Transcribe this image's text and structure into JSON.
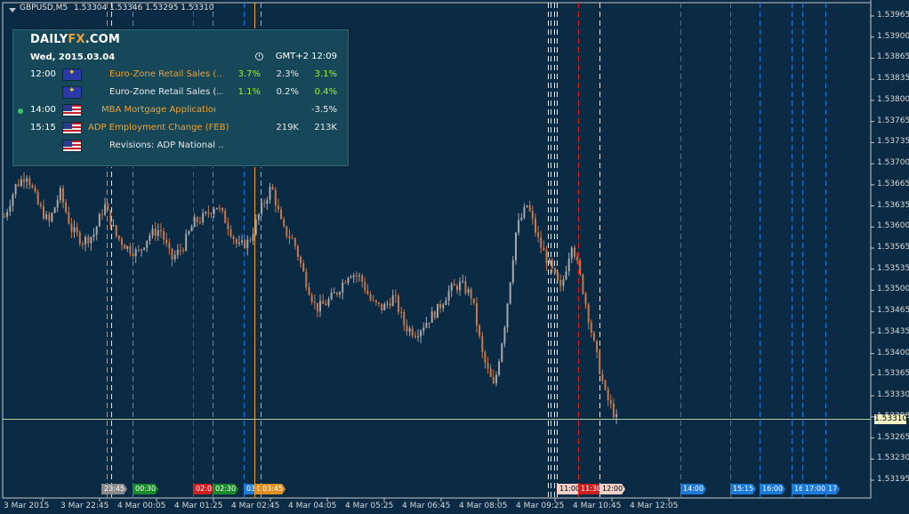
{
  "symbol": {
    "icon": "dropdown-triangle-icon",
    "title": "GBPUSD,M5",
    "ohlc": "1.53304 1.53346 1.53295 1.53310"
  },
  "panel": {
    "logo_prefix": "DAILY",
    "logo_fx": "FX",
    "logo_suffix": ".COM",
    "date": "Wed, 2015.03.04",
    "clock_icon": "clock-icon",
    "timezone": "GMT+2 12:09",
    "rows": [
      {
        "time": "12:00",
        "flag": "eu-flag",
        "name": "Euro-Zone Retail Sales (...",
        "name_color": "orange",
        "actual": "3.7%",
        "actual_color": "green",
        "forecast": "2.3%",
        "previous": "3.1%",
        "previous_color": "green",
        "dot": false
      },
      {
        "time": "",
        "flag": "eu-flag",
        "name": "Euro-Zone Retail Sales (...",
        "name_color": "white",
        "actual": "1.1%",
        "actual_color": "green",
        "forecast": "0.2%",
        "previous": "0.4%",
        "previous_color": "green",
        "dot": false
      },
      {
        "time": "14:00",
        "flag": "us-flag",
        "name": "MBA Mortgage Application...",
        "name_color": "orange",
        "actual": "",
        "actual_color": "white",
        "forecast": "",
        "previous": "-3.5%",
        "previous_color": "white",
        "dot": true
      },
      {
        "time": "15:15",
        "flag": "us-flag",
        "name": "ADP Employment Change (FEB)",
        "name_color": "orange",
        "actual": "",
        "actual_color": "white",
        "forecast": "219K",
        "previous": "213K",
        "previous_color": "white",
        "dot": false
      },
      {
        "time": "",
        "flag": "us-flag",
        "name": "Revisions: ADP National ...",
        "name_color": "white",
        "actual": "",
        "actual_color": "white",
        "forecast": "",
        "previous": "",
        "previous_color": "white",
        "dot": false
      }
    ]
  },
  "chart_data": {
    "type": "candlestick",
    "price_axis_labels": [
      "1.53965",
      "1.53900",
      "1.53865",
      "1.53835",
      "1.53800",
      "1.53765",
      "1.53735",
      "1.53700",
      "1.53665",
      "1.53635",
      "1.53600",
      "1.53565",
      "1.53535",
      "1.53500",
      "1.53465",
      "1.53435",
      "1.53400",
      "1.53365",
      "1.53330",
      "1.53298",
      "1.53265",
      "1.53230",
      "1.53195"
    ],
    "time_axis_labels": [
      "3 Mar 2015",
      "3 Mar 22:45",
      "4 Mar 00:05",
      "4 Mar 01:25",
      "4 Mar 02:45",
      "4 Mar 04:05",
      "4 Mar 05:25",
      "4 Mar 06:45",
      "4 Mar 08:05",
      "4 Mar 09:25",
      "4 Mar 10:45",
      "4 Mar 12:05"
    ],
    "current_price": "1.53310",
    "y_range": [
      1.531806,
      1.539896
    ],
    "closes": [
      1.5364,
      1.5369,
      1.5371,
      1.5366,
      1.5363,
      1.5368,
      1.5362,
      1.536,
      1.5361,
      1.5366,
      1.5361,
      1.5359,
      1.5358,
      1.5361,
      1.5362,
      1.5357,
      1.5359,
      1.5363,
      1.5364,
      1.5366,
      1.5363,
      1.5359,
      1.536,
      1.5365,
      1.5369,
      1.5362,
      1.536,
      1.5354,
      1.5349,
      1.535,
      1.5352,
      1.5355,
      1.5354,
      1.535,
      1.5349,
      1.5351,
      1.5346,
      1.5345,
      1.5347,
      1.5349,
      1.5352,
      1.5353,
      1.5351,
      1.5341,
      1.5336,
      1.5347,
      1.5362,
      1.5366,
      1.536,
      1.5356,
      1.5352,
      1.536,
      1.5352,
      1.5343,
      1.5335,
      1.5331
    ],
    "vlines": [
      {
        "pos": 0.1202,
        "color": "#9a9a9a",
        "style": "dash"
      },
      {
        "pos": 0.1254,
        "color": "#e8e8e8",
        "style": "dash"
      },
      {
        "pos": 0.1491,
        "color": "#30c030",
        "style": "dash"
      },
      {
        "pos": 0.2193,
        "color": "#e02020",
        "style": "dash"
      },
      {
        "pos": 0.2421,
        "color": "#30c030",
        "style": "dash"
      },
      {
        "pos": 0.2772,
        "color": "#1e7ad8",
        "style": "dash"
      },
      {
        "pos": 0.2895,
        "color": "#f0a030",
        "style": "solid"
      },
      {
        "pos": 0.2974,
        "color": "#f0a030",
        "style": "dash"
      },
      {
        "pos": 0.6281,
        "color": "#e8e8e8",
        "style": "dash"
      },
      {
        "pos": 0.6316,
        "color": "#e8e8e8",
        "style": "dash"
      },
      {
        "pos": 0.6351,
        "color": "#e8e8e8",
        "style": "dash"
      },
      {
        "pos": 0.6386,
        "color": "#e8e8e8",
        "style": "dash"
      },
      {
        "pos": 0.6632,
        "color": "#e02020",
        "style": "dash"
      },
      {
        "pos": 0.6877,
        "color": "#e8e8e8",
        "style": "dash"
      },
      {
        "pos": 0.7807,
        "color": "#1e7ad8",
        "style": "dash"
      },
      {
        "pos": 0.8386,
        "color": "#1e7ad8",
        "style": "dash"
      },
      {
        "pos": 0.8719,
        "color": "#1e7ad8",
        "style": "dash"
      },
      {
        "pos": 0.9088,
        "color": "#1e7ad8",
        "style": "dash"
      },
      {
        "pos": 0.9211,
        "color": "#1e7ad8",
        "style": "dash"
      },
      {
        "pos": 0.9474,
        "color": "#1e7ad8",
        "style": "dash"
      }
    ]
  },
  "event_tags": [
    {
      "label": "23:45",
      "bg": "#8a8a8a",
      "color": "#ffffff",
      "pos": 0.114
    },
    {
      "label": "00:30",
      "bg": "#1a8a2a",
      "color": "#ffffff",
      "pos": 0.1491
    },
    {
      "label": "02:0",
      "bg": "#d02020",
      "color": "#ffffff",
      "pos": 0.2193
    },
    {
      "label": "02:30",
      "bg": "#1a8a2a",
      "color": "#ffffff",
      "pos": 0.2421
    },
    {
      "label": "03",
      "bg": "#1e7ad8",
      "color": "#ffffff",
      "pos": 0.2772
    },
    {
      "label": "0",
      "bg": "#e09020",
      "color": "#ffffff",
      "pos": 0.2895
    },
    {
      "label": "03:45",
      "bg": "#e09020",
      "color": "#ffffff",
      "pos": 0.2965
    },
    {
      "label": "11:00",
      "bg": "#f0d0c8",
      "color": "#000000",
      "pos": 0.6386
    },
    {
      "label": "11:30",
      "bg": "#d02020",
      "color": "#ffffff",
      "pos": 0.6632
    },
    {
      "label": "12:00",
      "bg": "#f0d0c8",
      "color": "#000000",
      "pos": 0.6877
    },
    {
      "label": "14:00",
      "bg": "#1e7ad8",
      "color": "#ffffff",
      "pos": 0.7807
    },
    {
      "label": "15:15",
      "bg": "#1e7ad8",
      "color": "#ffffff",
      "pos": 0.8386
    },
    {
      "label": "16:00",
      "bg": "#1e7ad8",
      "color": "#ffffff",
      "pos": 0.8719
    },
    {
      "label": "16",
      "bg": "#1e7ad8",
      "color": "#ffffff",
      "pos": 0.9088
    },
    {
      "label": "17:00",
      "bg": "#1e7ad8",
      "color": "#ffffff",
      "pos": 0.9211
    },
    {
      "label": "17",
      "bg": "#1e7ad8",
      "color": "#ffffff",
      "pos": 0.9474
    }
  ],
  "colors": {
    "background": "#0b2a44",
    "bull": "#a8a8a8",
    "bear": "#c8784a",
    "grid": "#c8c8c8"
  }
}
